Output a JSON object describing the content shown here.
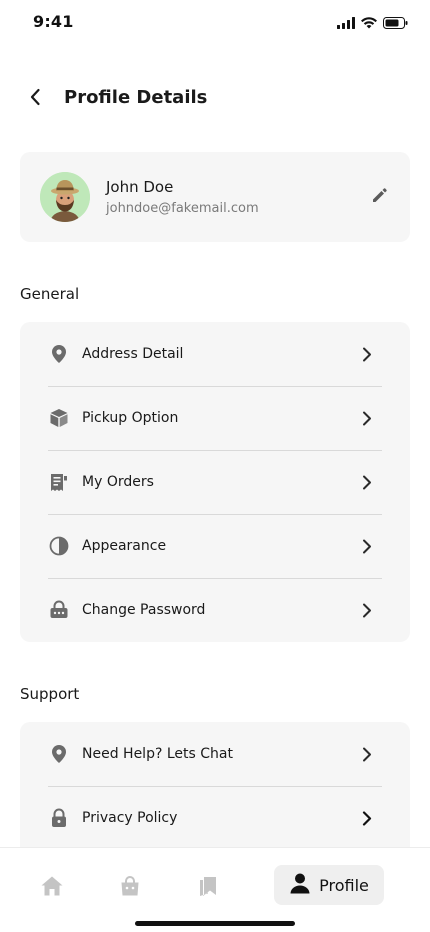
{
  "status_bar": {
    "time": "9:41"
  },
  "header": {
    "title": "Profile Details"
  },
  "profile": {
    "name": "John Doe",
    "email": "johndoe@fakemail.com"
  },
  "general": {
    "title": "General",
    "items": [
      {
        "label": "Address Detail",
        "icon": "location-pin-icon"
      },
      {
        "label": "Pickup Option",
        "icon": "box-icon"
      },
      {
        "label": "My Orders",
        "icon": "receipt-icon"
      },
      {
        "label": "Appearance",
        "icon": "contrast-icon"
      },
      {
        "label": "Change Password",
        "icon": "password-lock-icon"
      }
    ]
  },
  "support": {
    "title": "Support",
    "items": [
      {
        "label": "Need Help? Lets Chat",
        "icon": "location-pin-icon"
      },
      {
        "label": "Privacy Policy",
        "icon": "lock-icon"
      }
    ]
  },
  "bottom_nav": {
    "items": [
      {
        "icon": "home-icon"
      },
      {
        "icon": "shopping-bag-icon"
      },
      {
        "icon": "bookmarks-icon"
      },
      {
        "icon": "user-icon",
        "label": "Profile",
        "active": true
      }
    ]
  },
  "colors": {
    "card_bg": "#f6f6f6",
    "avatar_bg": "#bfe8b9",
    "icon_gray": "#6b6b6b",
    "inactive_nav": "#c4c4c4"
  }
}
